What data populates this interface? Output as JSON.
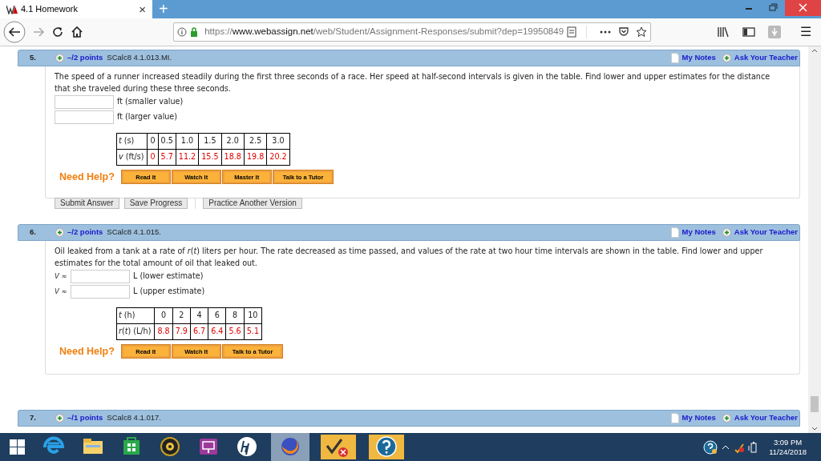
{
  "browser": {
    "tab_title": "4.1 Homework",
    "tab_close": "×",
    "new_tab": "+",
    "url": {
      "scheme": "https://",
      "host": "www.webassign.net",
      "path": "/web/Student/Assignment-Responses/submit?dep=19950849"
    },
    "menu": "☰"
  },
  "questions": [
    {
      "number": "5.",
      "points": "–/2 points",
      "code": "SCalc8 4.1.013.MI.",
      "notes": "My Notes",
      "ask": "Ask Your Teacher",
      "text": "The speed of a runner increased steadily during the first three seconds of a race. Her speed at half-second intervals is given in the table. Find lower and upper estimates for the distance that she traveled during these three seconds.",
      "answers": [
        {
          "unit": "ft (smaller value)"
        },
        {
          "unit": "ft (larger value)"
        }
      ],
      "table": [
        {
          "kind": "input",
          "label": "*t* (s)",
          "values": [
            "0",
            "0.5",
            "1.0",
            "1.5",
            "2.0",
            "2.5",
            "3.0"
          ]
        },
        {
          "kind": "output",
          "label": "*v* (ft/s)",
          "values": [
            "0",
            "5.7",
            "11.2",
            "15.5",
            "18.8",
            "19.8",
            "20.2"
          ]
        }
      ],
      "need_help": "Need Help?",
      "help_buttons": [
        "Read It",
        "Watch It",
        "Master It",
        "Talk to a Tutor"
      ],
      "actions": [
        "Submit Answer",
        "Save Progress",
        "Practice Another Version"
      ]
    },
    {
      "number": "6.",
      "points": "–/2 points",
      "code": "SCalc8 4.1.015.",
      "notes": "My Notes",
      "ask": "Ask Your Teacher",
      "text": "Oil leaked from a tank at a rate of *r*(*t*) liters per hour. The rate decreased as time passed, and values of the rate at two hour time intervals are shown in the table. Find lower and upper estimates for the total amount of oil that leaked out.",
      "answers": [
        {
          "prefix": "*V* ≈",
          "unit": "L (lower estimate)"
        },
        {
          "prefix": "*V* ≈",
          "unit": "L (upper estimate)"
        }
      ],
      "table": [
        {
          "kind": "input",
          "label": "*t* (h)",
          "values": [
            "0",
            "2",
            "4",
            "6",
            "8",
            "10"
          ]
        },
        {
          "kind": "output",
          "label": "*r*(*t*) (L/h)",
          "values": [
            "8.8",
            "7.9",
            "6.7",
            "6.4",
            "5.6",
            "5.1"
          ]
        }
      ],
      "need_help": "Need Help?",
      "help_buttons": [
        "Read It",
        "Watch It",
        "Talk to a Tutor"
      ]
    },
    {
      "number": "7.",
      "points": "–/1 points",
      "code": "SCalc8 4.1.017.",
      "notes": "My Notes",
      "ask": "Ask Your Teacher"
    }
  ],
  "taskbar": {
    "apps": [
      {
        "kind": "ie",
        "active": false
      },
      {
        "kind": "files",
        "active": false
      },
      {
        "kind": "store",
        "active": false
      },
      {
        "kind": "media",
        "active": false
      },
      {
        "kind": "connect",
        "active": false
      },
      {
        "kind": "hp",
        "active": false
      },
      {
        "kind": "firefox",
        "active": true
      },
      {
        "kind": "webassign",
        "active": false
      },
      {
        "kind": "help",
        "active": false
      }
    ],
    "time": "3:09 PM",
    "date": "11/24/2018"
  }
}
